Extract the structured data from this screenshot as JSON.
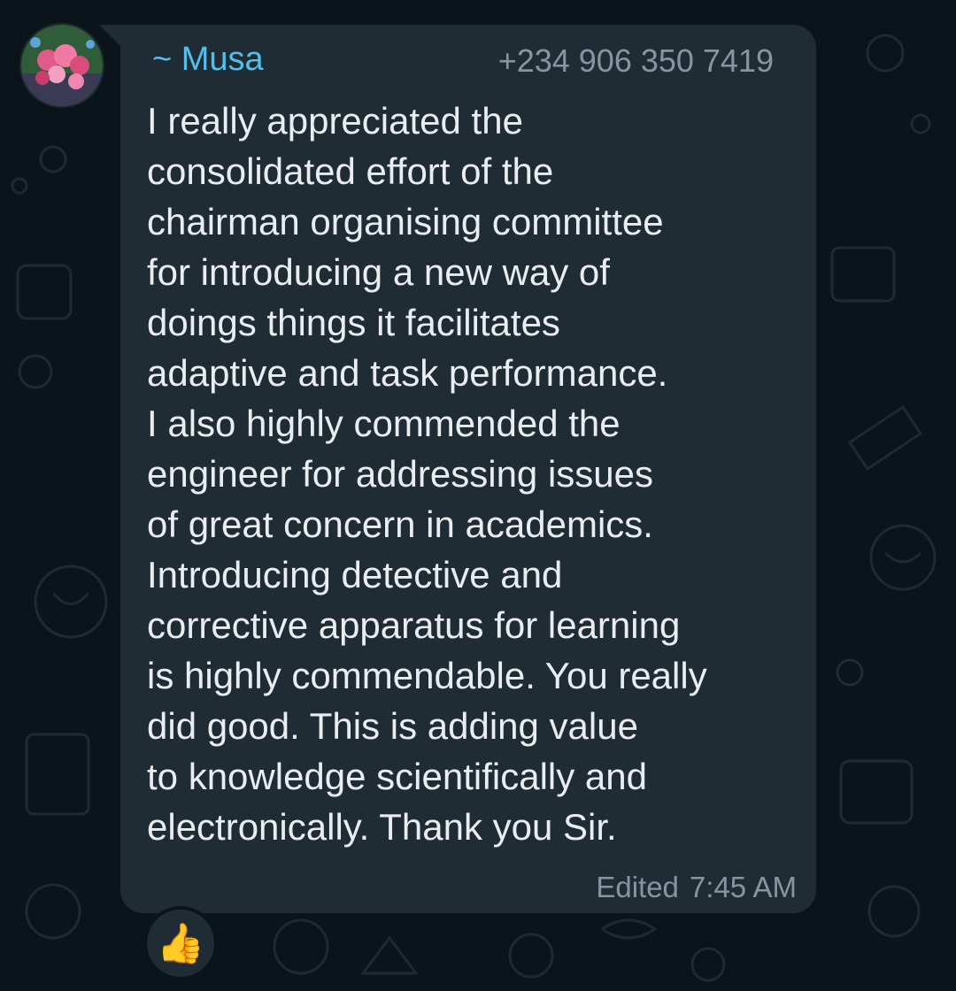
{
  "message": {
    "sender": "~ Musa",
    "phone": "+234 906 350 7419",
    "lines": [
      "I really appreciated the",
      "consolidated effort of the",
      "chairman organising committee",
      "for introducing a new way of",
      "doings things it facilitates",
      "adaptive and task performance.",
      "I also highly commended the",
      "engineer for addressing issues",
      "of great concern in academics.",
      "Introducing detective and",
      "corrective apparatus for learning",
      "is highly commendable. You really",
      "did good. This is adding value",
      "to knowledge scientifically and",
      "electronically. Thank you Sir."
    ],
    "edited_label": "Edited",
    "time": "7:45 AM"
  },
  "reaction": {
    "emoji": "👍",
    "icon": "thumbs-up-icon"
  },
  "avatar": {
    "icon": "flower-photo-avatar"
  },
  "colors": {
    "background": "#0b141a",
    "bubble": "#202c33",
    "sender": "#53bdeb",
    "text": "#e9edef",
    "meta": "#8696a0"
  }
}
